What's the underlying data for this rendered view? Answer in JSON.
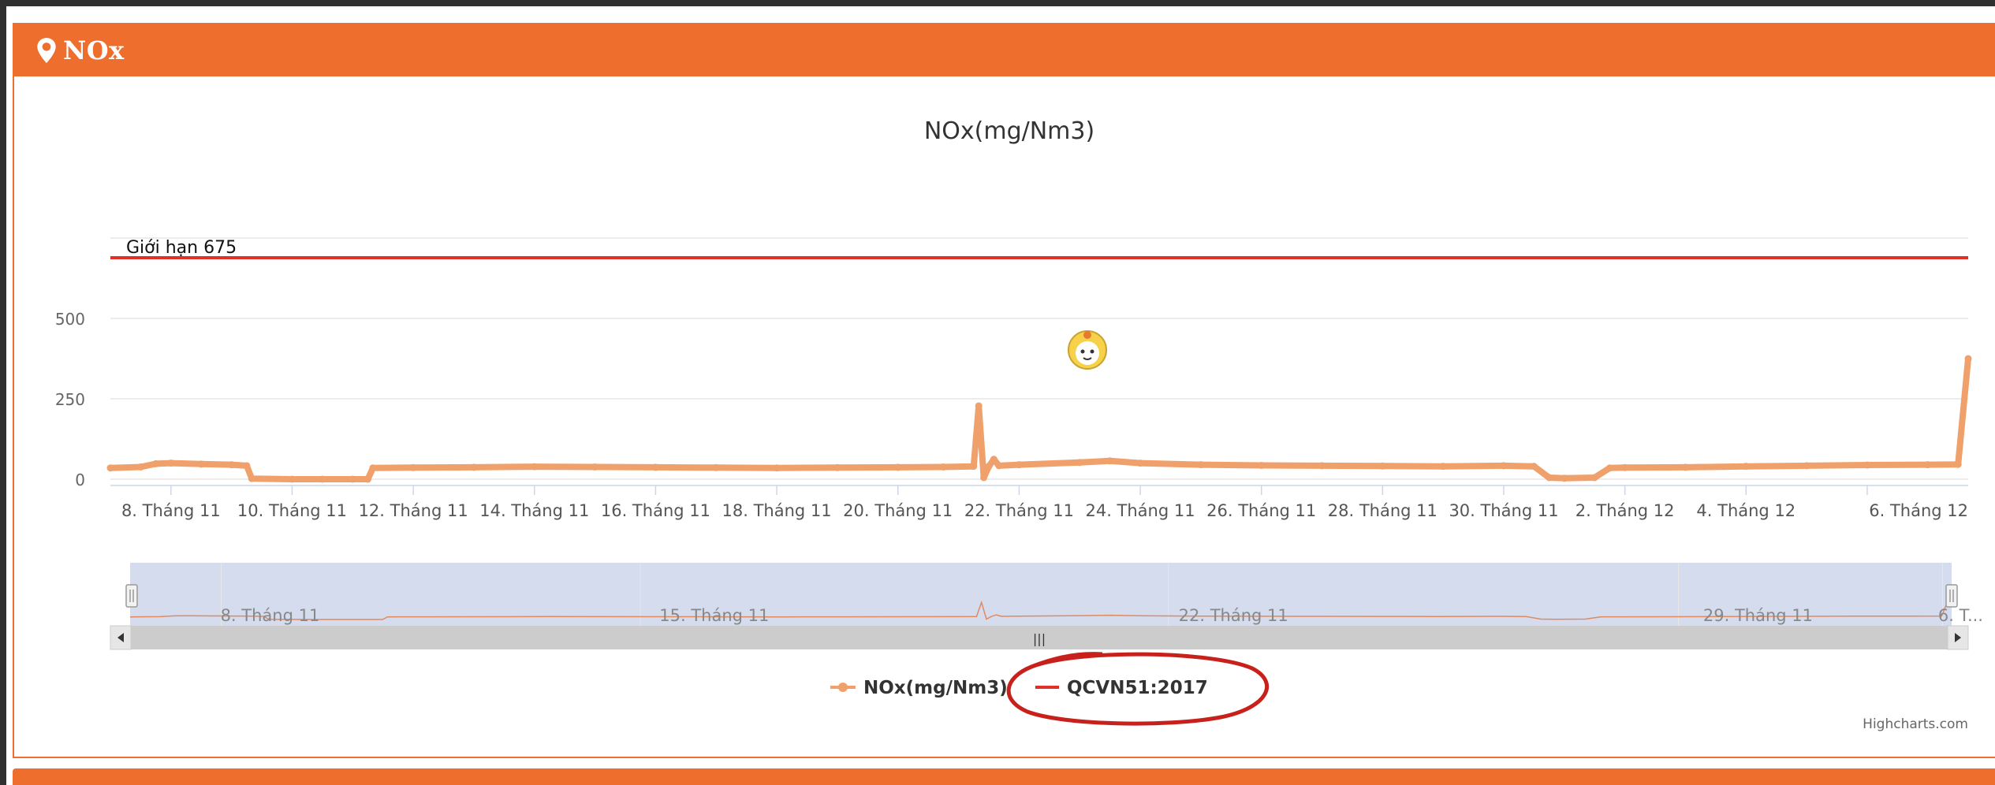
{
  "panel": {
    "title": "NOx",
    "icon": "map-marker-icon",
    "accent_color": "#ee6e2d"
  },
  "chart_data": {
    "type": "line",
    "title": "NOx(mg/Nm3)",
    "xlabel": "",
    "ylabel": "",
    "ylim": [
      0,
      750
    ],
    "y_ticks": [
      0,
      250,
      500
    ],
    "y_tick_labels": [
      "0",
      "250",
      "500"
    ],
    "x_tick_labels": [
      "8. Tháng 11",
      "10. Tháng 11",
      "12. Tháng 11",
      "14. Tháng 11",
      "16. Tháng 11",
      "18. Tháng 11",
      "20. Tháng 11",
      "22. Tháng 11",
      "24. Tháng 11",
      "26. Tháng 11",
      "28. Tháng 11",
      "30. Tháng 11",
      "2. Tháng 12",
      "4. Tháng 12",
      "6. Tháng 12"
    ],
    "x_range_days": [
      "2019-11-07",
      "2019-12-07"
    ],
    "plot_band_line": {
      "label": "Giới hạn 675",
      "value": 675,
      "color": "#e0302a"
    },
    "series": [
      {
        "name": "NOx(mg/Nm3)",
        "color": "#f0a06a",
        "points": [
          [
            "2019-11-07 00:00",
            35
          ],
          [
            "2019-11-07 12:00",
            38
          ],
          [
            "2019-11-07 18:00",
            48
          ],
          [
            "2019-11-08 00:00",
            50
          ],
          [
            "2019-11-08 12:00",
            47
          ],
          [
            "2019-11-09 00:00",
            45
          ],
          [
            "2019-11-09 06:00",
            42
          ],
          [
            "2019-11-09 08:00",
            2
          ],
          [
            "2019-11-10 00:00",
            0
          ],
          [
            "2019-11-10 12:00",
            0
          ],
          [
            "2019-11-11 00:00",
            0
          ],
          [
            "2019-11-11 06:00",
            0
          ],
          [
            "2019-11-11 08:00",
            35
          ],
          [
            "2019-11-12 00:00",
            36
          ],
          [
            "2019-11-13 00:00",
            37
          ],
          [
            "2019-11-14 00:00",
            39
          ],
          [
            "2019-11-15 00:00",
            38
          ],
          [
            "2019-11-16 00:00",
            37
          ],
          [
            "2019-11-17 00:00",
            36
          ],
          [
            "2019-11-18 00:00",
            35
          ],
          [
            "2019-11-19 00:00",
            36
          ],
          [
            "2019-11-20 00:00",
            37
          ],
          [
            "2019-11-20 18:00",
            38
          ],
          [
            "2019-11-21 06:00",
            40
          ],
          [
            "2019-11-21 08:00",
            228
          ],
          [
            "2019-11-21 10:00",
            5
          ],
          [
            "2019-11-21 12:00",
            40
          ],
          [
            "2019-11-21 14:00",
            62
          ],
          [
            "2019-11-21 16:00",
            42
          ],
          [
            "2019-11-22 00:00",
            45
          ],
          [
            "2019-11-23 00:00",
            52
          ],
          [
            "2019-11-23 12:00",
            57
          ],
          [
            "2019-11-24 00:00",
            50
          ],
          [
            "2019-11-25 00:00",
            45
          ],
          [
            "2019-11-26 00:00",
            43
          ],
          [
            "2019-11-27 00:00",
            42
          ],
          [
            "2019-11-28 00:00",
            41
          ],
          [
            "2019-11-29 00:00",
            40
          ],
          [
            "2019-11-30 00:00",
            42
          ],
          [
            "2019-11-30 12:00",
            40
          ],
          [
            "2019-11-30 18:00",
            5
          ],
          [
            "2019-12-01 00:00",
            3
          ],
          [
            "2019-12-01 12:00",
            5
          ],
          [
            "2019-12-01 18:00",
            35
          ],
          [
            "2019-12-02 00:00",
            36
          ],
          [
            "2019-12-03 00:00",
            37
          ],
          [
            "2019-12-04 00:00",
            40
          ],
          [
            "2019-12-05 00:00",
            42
          ],
          [
            "2019-12-06 00:00",
            44
          ],
          [
            "2019-12-07 00:00",
            45
          ],
          [
            "2019-12-07 12:00",
            46
          ],
          [
            "2019-12-07 16:00",
            375
          ]
        ]
      },
      {
        "name": "QCVN51:2017",
        "color": "#e0302a",
        "value": 675
      }
    ],
    "navigator": {
      "x_tick_labels": [
        "8. Tháng 11",
        "15. Tháng 11",
        "22. Tháng 11",
        "29. Tháng 11",
        "6. T..."
      ],
      "handle_glyph": "|||"
    },
    "legend_placement": "bottom-center",
    "credits": "Highcharts.com"
  }
}
